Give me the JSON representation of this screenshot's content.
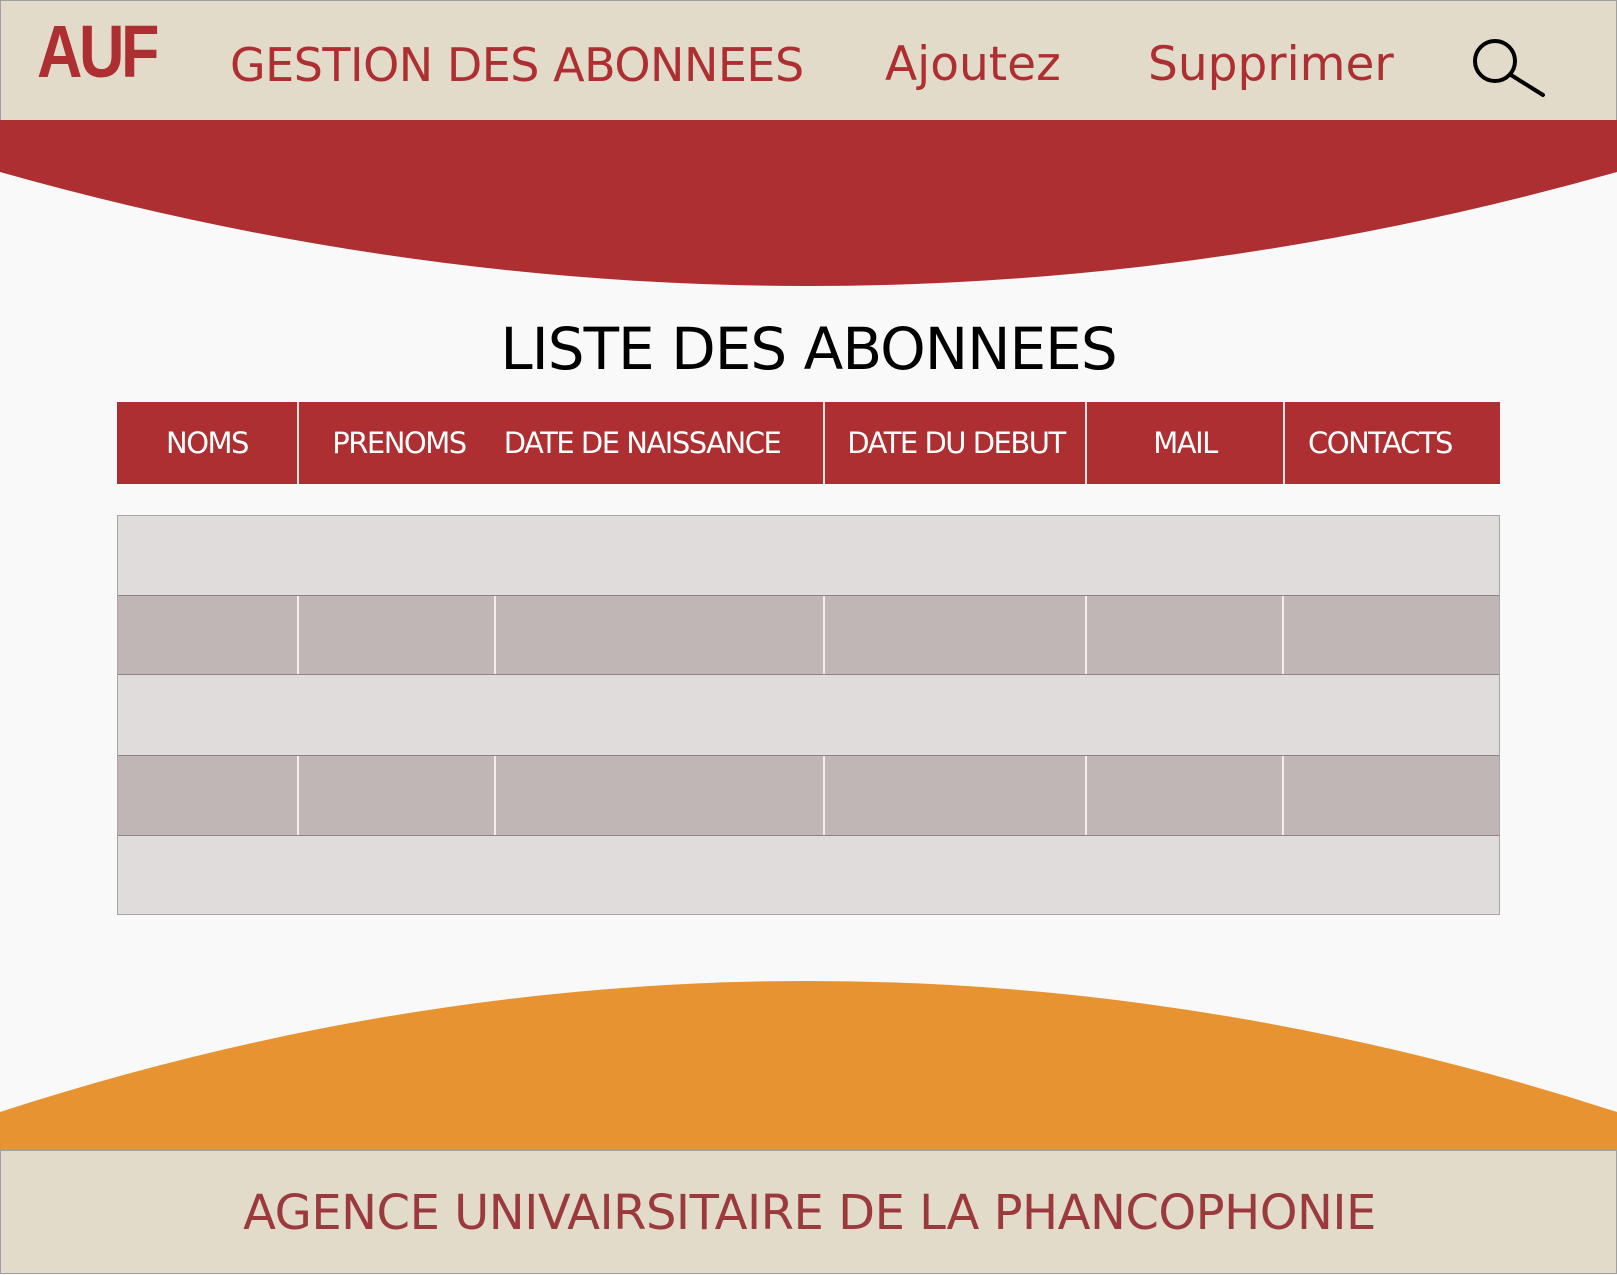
{
  "header": {
    "logo": "AUF",
    "title": "GESTION DES ABONNEES",
    "add_label": "Ajoutez",
    "delete_label": "Supprimer",
    "search_icon": "search-icon"
  },
  "main": {
    "title": "LISTE DES ABONNEES",
    "columns": [
      "NOMS",
      "PRENOMS",
      "DATE DE NAISSANCE",
      "DATE DU DEBUT",
      "MAIL",
      "CONTACTS"
    ],
    "rows": [
      [
        "",
        "",
        "",
        "",
        "",
        ""
      ],
      [
        "",
        "",
        "",
        "",
        "",
        ""
      ],
      [
        "",
        "",
        "",
        "",
        "",
        ""
      ],
      [
        "",
        "",
        "",
        "",
        "",
        ""
      ],
      [
        "",
        "",
        "",
        "",
        "",
        ""
      ]
    ]
  },
  "footer": {
    "text": "AGENCE UNIVAIRSITAIRE DE LA PHANCOPHONIE"
  },
  "colors": {
    "brand_red": "#ad2f31",
    "accent_orange": "#e89331",
    "bar_beige": "#e3dbca"
  }
}
